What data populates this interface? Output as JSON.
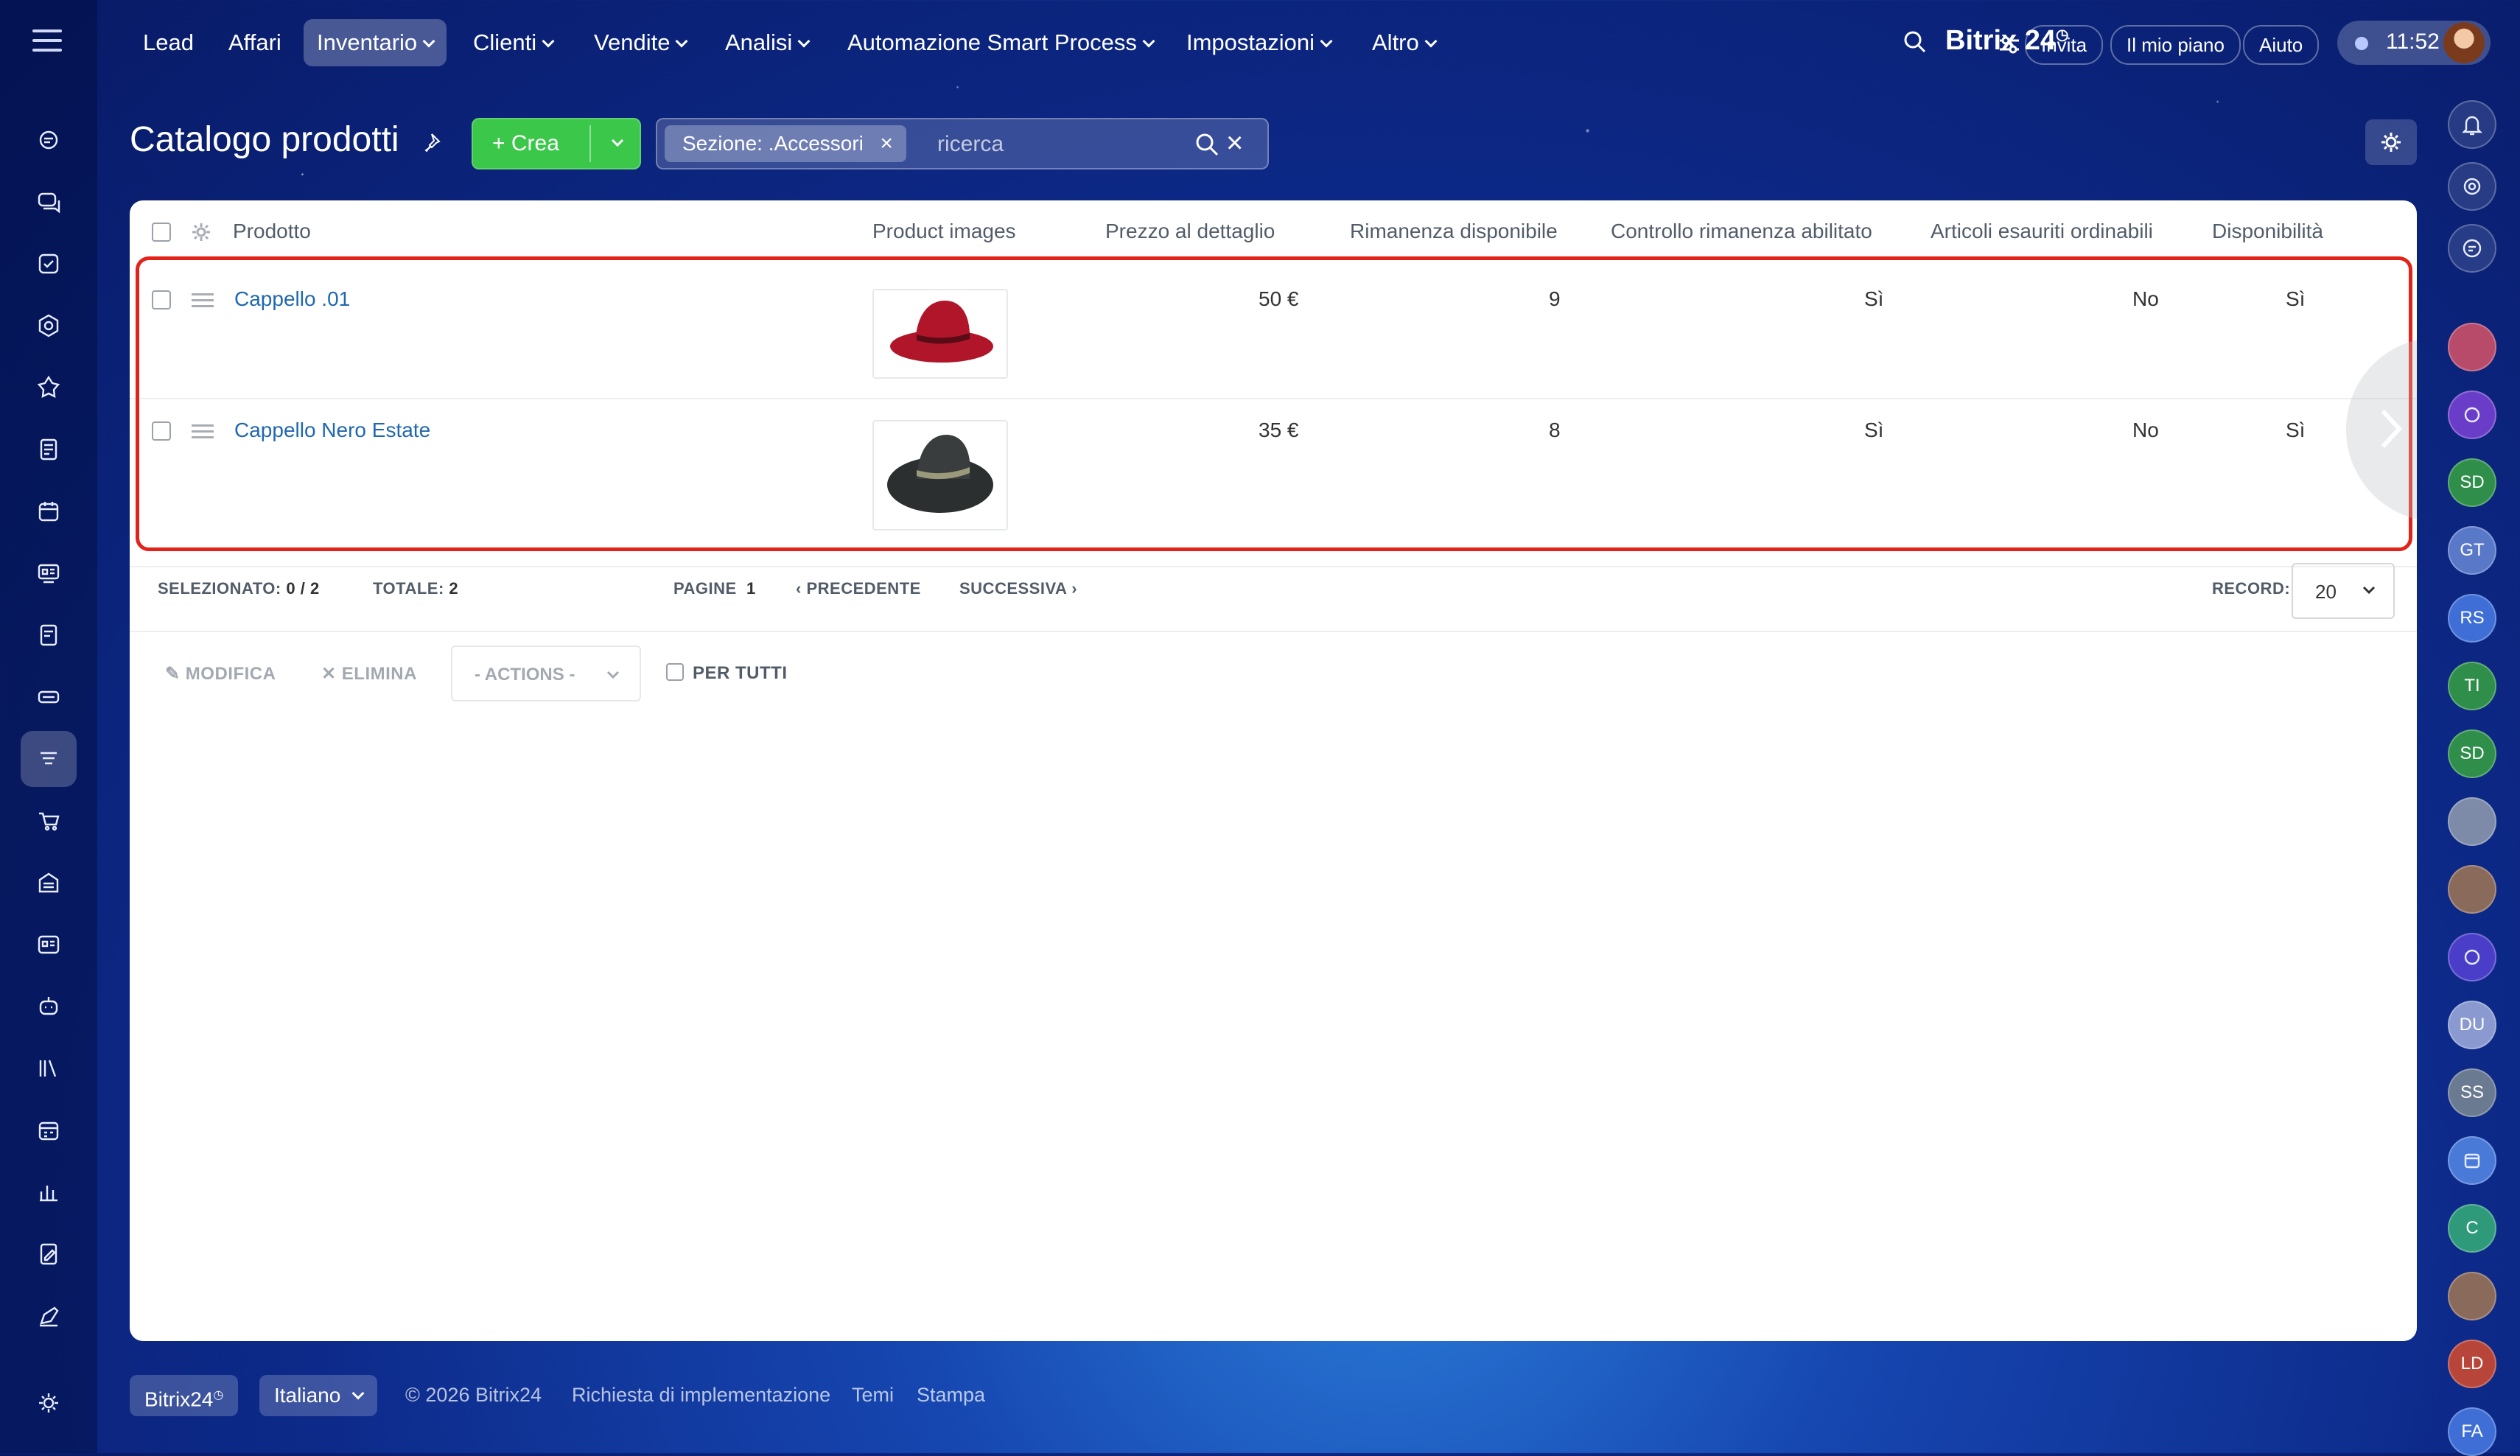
{
  "nav": {
    "items": [
      "Lead",
      "Affari",
      "Inventario",
      "Clienti",
      "Vendite",
      "Analisi",
      "Automazione Smart Process",
      "Impostazioni",
      "Altro"
    ],
    "brand": "Bitrix",
    "brand_num": "24",
    "invite": "Invita",
    "plan": "Il mio piano",
    "help": "Aiuto",
    "time": "11:52"
  },
  "page": {
    "title": "Catalogo prodotti",
    "create_label": "Crea",
    "filter_chip": "Sezione: .Accessori",
    "search_placeholder": "ricerca"
  },
  "table": {
    "headers": [
      "Prodotto",
      "Product images",
      "Prezzo al dettaglio",
      "Rimanenza disponibile",
      "Controllo rimanenza abilitato",
      "Articoli esauriti ordinabili",
      "Disponibilità"
    ],
    "rows": [
      {
        "name": "Cappello .01",
        "price": "50 €",
        "stock": "9",
        "stock_control": "Sì",
        "backorder": "No",
        "available": "Sì",
        "hat_color": "#b0152a"
      },
      {
        "name": "Cappello Nero Estate",
        "price": "35 €",
        "stock": "8",
        "stock_control": "Sì",
        "backorder": "No",
        "available": "Sì",
        "hat_color": "#2c2f30"
      }
    ]
  },
  "footer": {
    "selected_label": "SELEZIONATO:",
    "selected_value": "0 / 2",
    "total_label": "TOTALE:",
    "total_value": "2",
    "pages_label": "PAGINE",
    "pages_value": "1",
    "prev": "PRECEDENTE",
    "next": "SUCCESSIVA",
    "record_label": "RECORD:",
    "record_value": "20"
  },
  "actions": {
    "edit": "MODIFICA",
    "delete": "ELIMINA",
    "select": "- ACTIONS -",
    "for_all": "PER TUTTI"
  },
  "right_rail": [
    "SD",
    "GT",
    "RS",
    "TI",
    "SD",
    "DU",
    "SS",
    "C",
    "LD",
    "FA"
  ],
  "bottom": {
    "brand": "Bitrix24",
    "language": "Italiano",
    "copyright": "© 2026 Bitrix24",
    "implement": "Richiesta di implementazione",
    "themes": "Temi",
    "print": "Stampa"
  }
}
